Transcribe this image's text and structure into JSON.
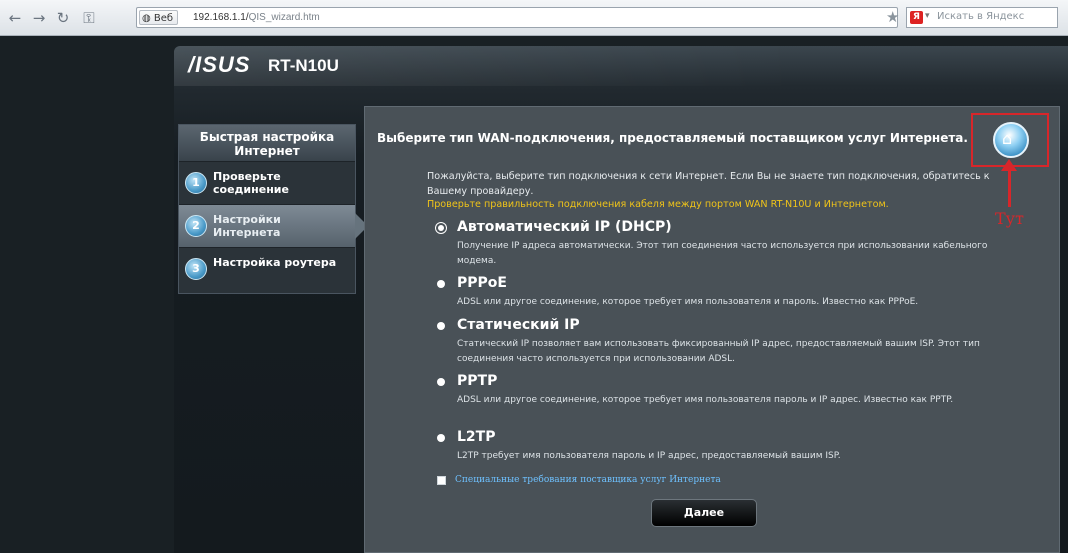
{
  "browser": {
    "site_badge": "Веб",
    "url_host": "192.168.1.1/",
    "url_path": "QIS_wizard.htm",
    "search_placeholder": "Искать в Яндекс"
  },
  "router": {
    "brand": "/ISUS",
    "model": "RT-N10U"
  },
  "sidebar": {
    "title": "Быстрая настройка Интернет",
    "steps": [
      {
        "num": "1",
        "label": "Проверьте соединение"
      },
      {
        "num": "2",
        "label": "Настройки Интернета"
      },
      {
        "num": "3",
        "label": "Настройка роутера"
      }
    ]
  },
  "content": {
    "title": "Выберите тип WAN-подключения, предоставляемый поставщиком услуг Интернета.",
    "intro": "Пожалуйста, выберите тип подключения к сети Интернет. Если Вы не знаете тип подключения, обратитесь к Вашему провайдеру.",
    "warning": "Проверьте правильность подключения кабеля между портом WAN RT-N10U и Интернетом.",
    "annotation": "Тут",
    "options": [
      {
        "name": "Автоматический IP (DHCP)",
        "desc": "Получение IP адреса автоматически. Этот тип соединения часто используется при использовании кабельного модема.",
        "selected": true
      },
      {
        "name": "PPPoE",
        "desc": "ADSL или другое соединение, которое требует имя пользователя и пароль. Известно как PPPoE.",
        "selected": false
      },
      {
        "name": "Статический IP",
        "desc": "Статический IP позволяет вам использовать фиксированный IP адрес, предоставляемый вашим ISP. Этот тип соединения часто используется при использовании ADSL.",
        "selected": false
      },
      {
        "name": "PPTP",
        "desc": "ADSL или другое соединение, которое требует имя пользователя пароль и IP адрес. Известно как PPTP.",
        "selected": false
      },
      {
        "name": "L2TP",
        "desc": "L2TP требует имя пользователя пароль и IP адрес, предоставляемый вашим ISP.",
        "selected": false
      }
    ],
    "special_label": "Специальные требования поставщика услуг Интернета",
    "next_label": "Далее"
  },
  "colors": {
    "accent_red": "#d8262a",
    "warning_yellow": "#f0c419",
    "link_blue": "#6ec1ff"
  }
}
